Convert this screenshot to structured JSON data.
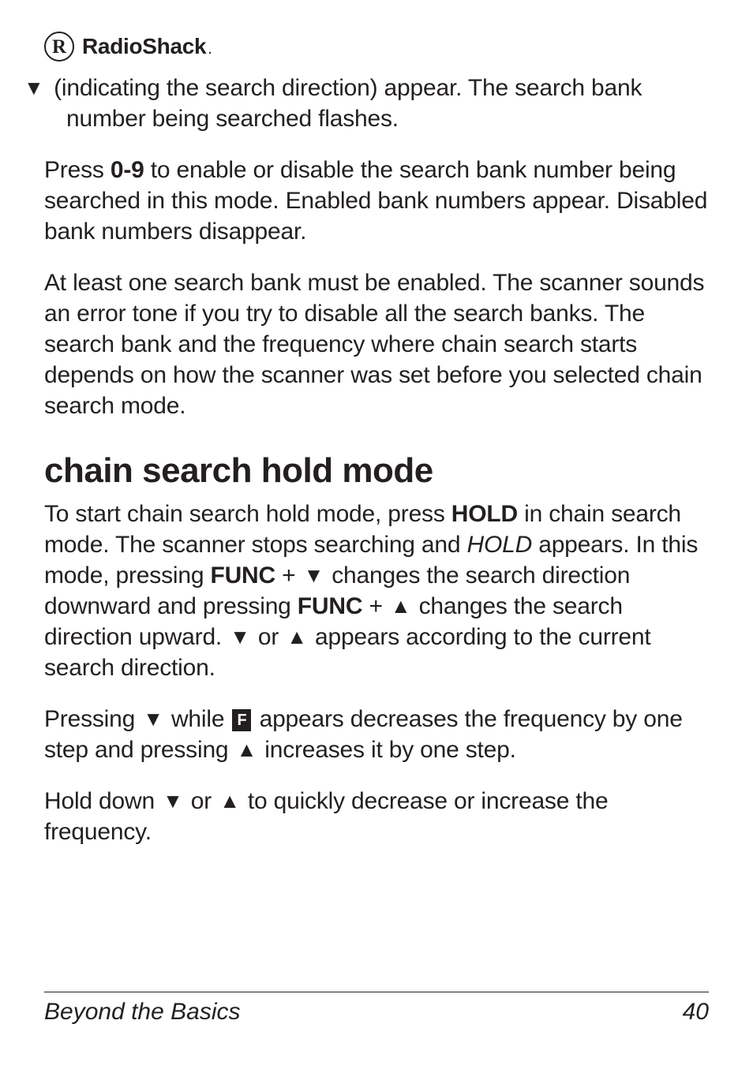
{
  "logo": {
    "r": "R",
    "text": "RadioShack",
    "dot": "."
  },
  "icons": {
    "down": "▼",
    "up": "▲",
    "fbox": "F"
  },
  "p1": {
    "a": "(indicating the search direction) appear. The search bank number being searched flashes."
  },
  "p2": {
    "a": "Press ",
    "key": "0-9",
    "b": " to enable or disable the search bank number being searched in this mode. Enabled bank numbers appear. Disabled bank numbers disappear."
  },
  "p3": {
    "a": "At least one search bank must be enabled. The scanner sounds an error tone if you try to disable all the search banks. The search bank and the frequency where chain search starts depends on how the scanner was set before you selected chain search mode."
  },
  "heading": "chain search hold mode",
  "p4": {
    "a": "To start chain search hold mode, press ",
    "hold": "HOLD",
    "b": " in chain search mode. The scanner stops searching and ",
    "holditalic": "HOLD",
    "c": " appears. In this mode, pressing ",
    "func1": "FUNC",
    "plus1": " + ",
    "d": " changes the search direction downward and pressing ",
    "func2": "FUNC",
    "plus2": " + ",
    "e": " changes the search direction upward. ",
    "or": " or ",
    "f": " appears according to the current search direction."
  },
  "p5": {
    "a": "Pressing ",
    "b": " while ",
    "c": " appears decreases the frequency by one step and pressing ",
    "d": " increases it by one step."
  },
  "p6": {
    "a": "Hold down ",
    "or": " or ",
    "b": " to quickly decrease or increase the frequency."
  },
  "footer": {
    "left": "Beyond the Basics",
    "right": "40"
  }
}
